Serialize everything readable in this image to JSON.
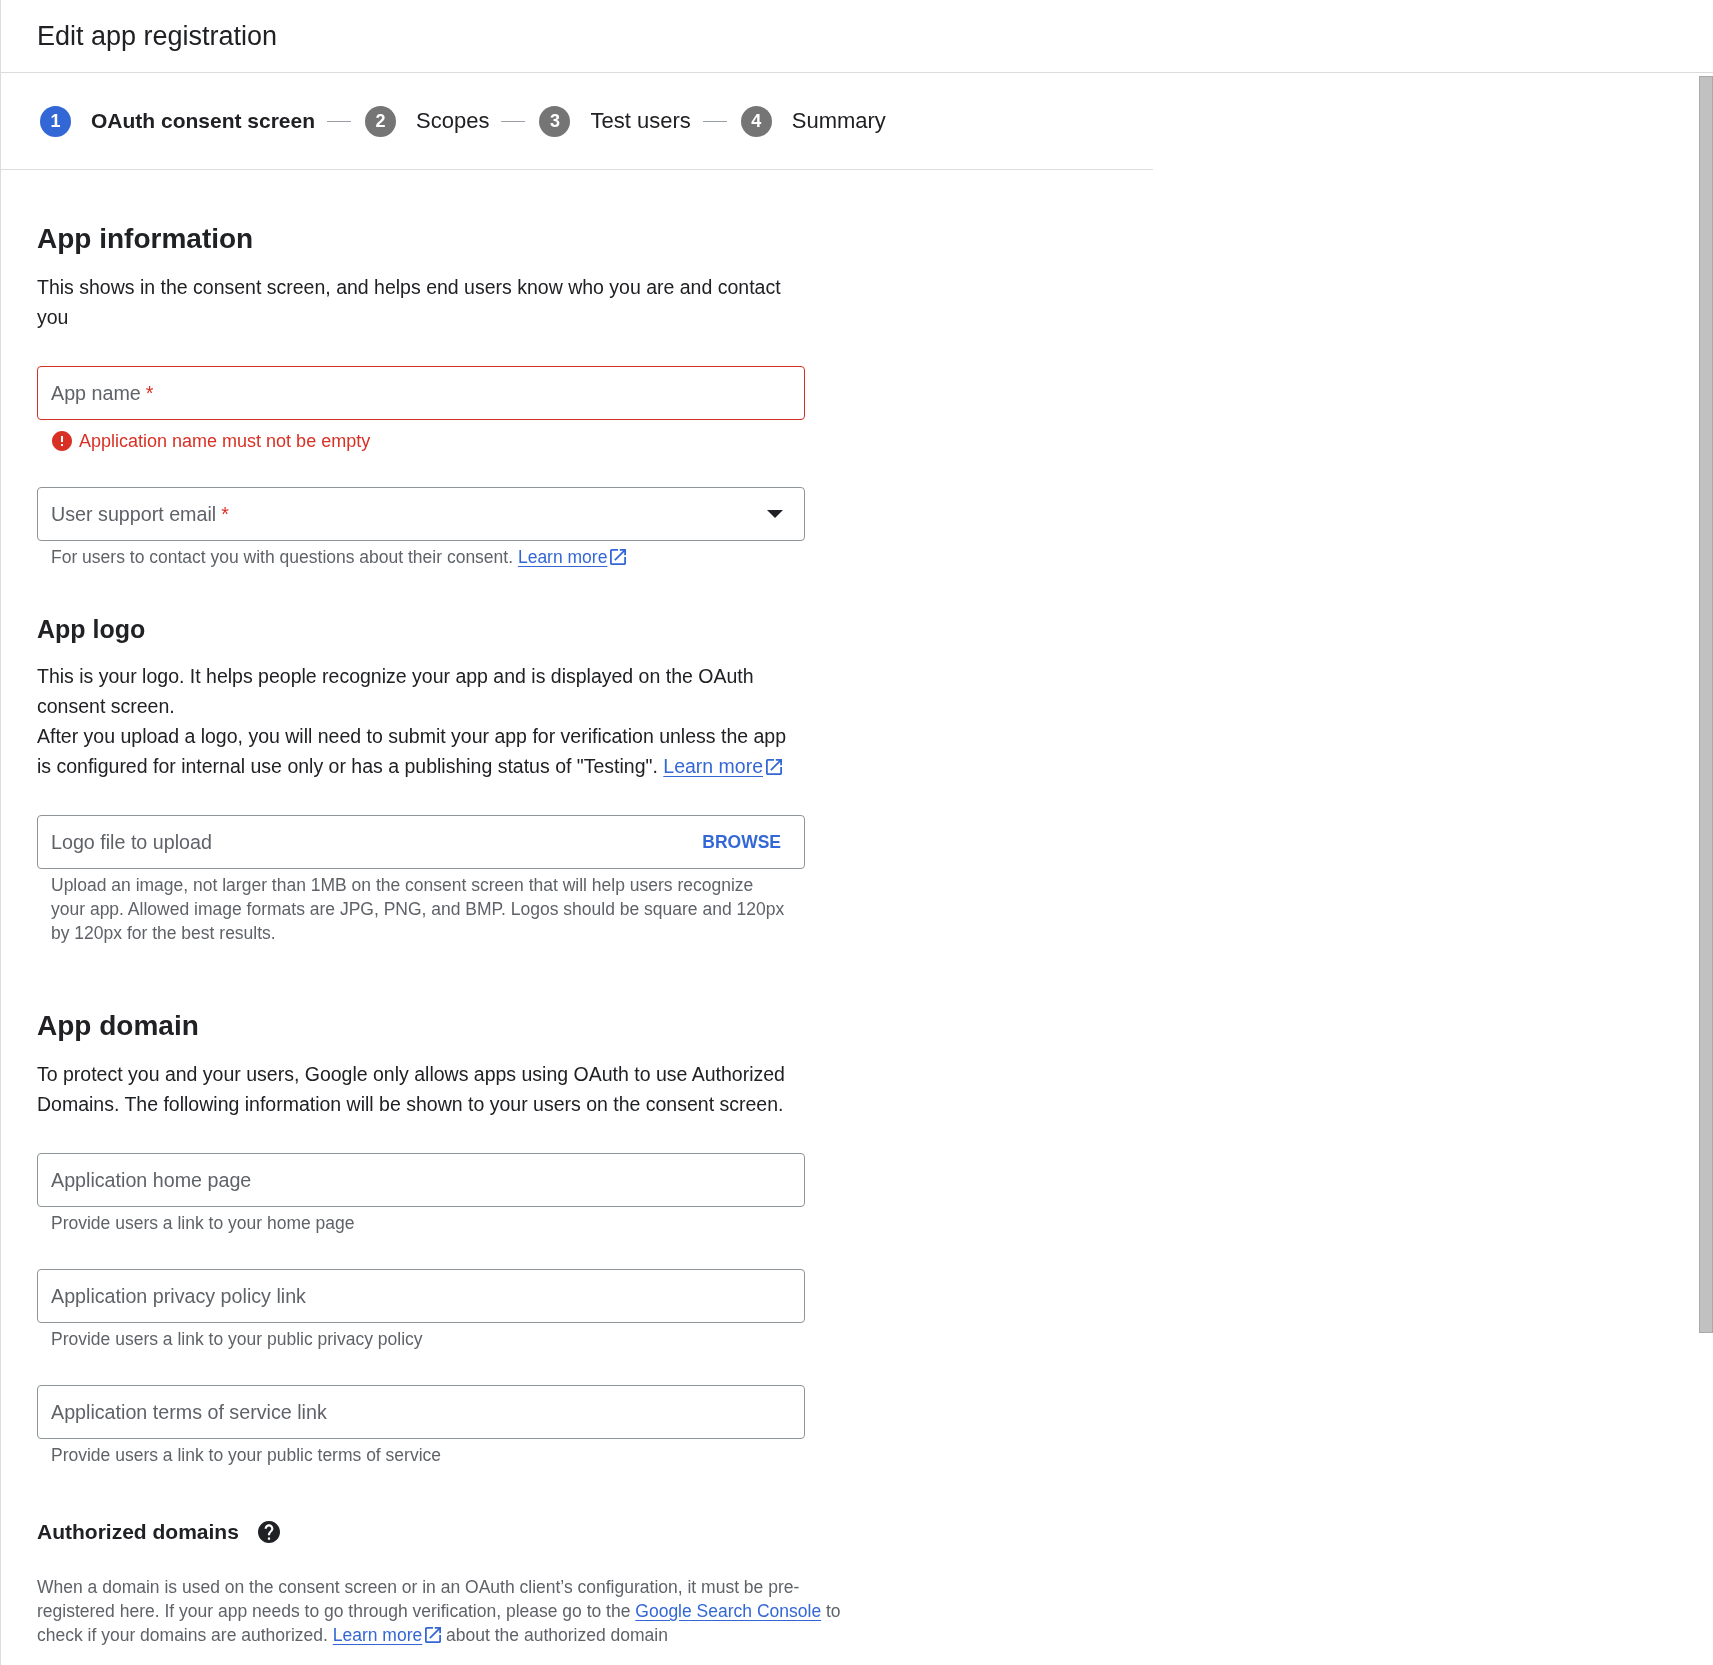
{
  "header": {
    "title": "Edit app registration"
  },
  "steps": [
    {
      "number": "1",
      "label": "OAuth consent screen",
      "selected": true
    },
    {
      "number": "2",
      "label": "Scopes",
      "selected": false
    },
    {
      "number": "3",
      "label": "Test users",
      "selected": false
    },
    {
      "number": "4",
      "label": "Summary",
      "selected": false
    }
  ],
  "form": [
    {
      "kind": "heading",
      "text": "App information"
    },
    {
      "kind": "paragraph",
      "parts": [
        {
          "kind": "text",
          "text": "This shows in the consent screen, and helps end users know who you are and contact you"
        }
      ]
    },
    {
      "kind": "text_field",
      "label": "App name",
      "required_mark": "*",
      "invalid": true,
      "error": "Application name must not be empty"
    },
    {
      "kind": "dropdown_field",
      "label": "User support email",
      "required_mark": "*",
      "invalid": false,
      "hint": [
        {
          "kind": "text",
          "text": "For users to contact you with questions about their consent. "
        },
        {
          "kind": "link",
          "text": "Learn more",
          "external": true
        }
      ]
    },
    {
      "kind": "subheading",
      "text": "App logo"
    },
    {
      "kind": "paragraph",
      "parts": [
        {
          "kind": "text",
          "text": "This is your logo. It helps people recognize your app and is displayed on the OAuth consent screen."
        }
      ]
    },
    {
      "kind": "paragraph",
      "parts": [
        {
          "kind": "text",
          "text": "After you upload a logo, you will need to submit your app for verification unless the app is configured for internal use only or has a publishing status of \"Testing\". "
        },
        {
          "kind": "link",
          "text": "Learn more",
          "external": true
        }
      ]
    },
    {
      "kind": "file_field",
      "label": "Logo file to upload",
      "action": "BROWSE",
      "invalid": false,
      "hint": [
        {
          "kind": "text",
          "text": "Upload an image, not larger than 1MB on the consent screen that will help users recognize your app. Allowed image formats are JPG, PNG, and BMP. Logos should be square and 120px by 120px for the best results."
        }
      ]
    },
    {
      "kind": "heading",
      "text": "App domain"
    },
    {
      "kind": "paragraph",
      "parts": [
        {
          "kind": "text",
          "text": "To protect you and your users, Google only allows apps using OAuth to use Authorized Domains. The following information will be shown to your users on the consent screen."
        }
      ]
    },
    {
      "kind": "text_field",
      "label": "Application home page",
      "invalid": false,
      "hint": [
        {
          "kind": "text",
          "text": "Provide users a link to your home page"
        }
      ]
    },
    {
      "kind": "text_field",
      "label": "Application privacy policy link",
      "invalid": false,
      "hint": [
        {
          "kind": "text",
          "text": "Provide users a link to your public privacy policy"
        }
      ]
    },
    {
      "kind": "text_field",
      "label": "Application terms of service link",
      "invalid": false,
      "hint": [
        {
          "kind": "text",
          "text": "Provide users a link to your public terms of service"
        }
      ]
    },
    {
      "kind": "minor_heading",
      "text": "Authorized domains",
      "help": true
    },
    {
      "kind": "note",
      "parts": [
        {
          "kind": "text",
          "text": "When a domain is used on the consent screen or in an OAuth client’s configuration, it must be pre-registered here. If your app needs to go through verification, please go to the "
        },
        {
          "kind": "link",
          "text": "Google Search Console",
          "external": false
        },
        {
          "kind": "text",
          "text": " to check if your domains are authorized. "
        },
        {
          "kind": "link",
          "text": "Learn more",
          "external": true
        },
        {
          "kind": "text",
          "text": " about the authorized domain"
        }
      ]
    }
  ]
}
